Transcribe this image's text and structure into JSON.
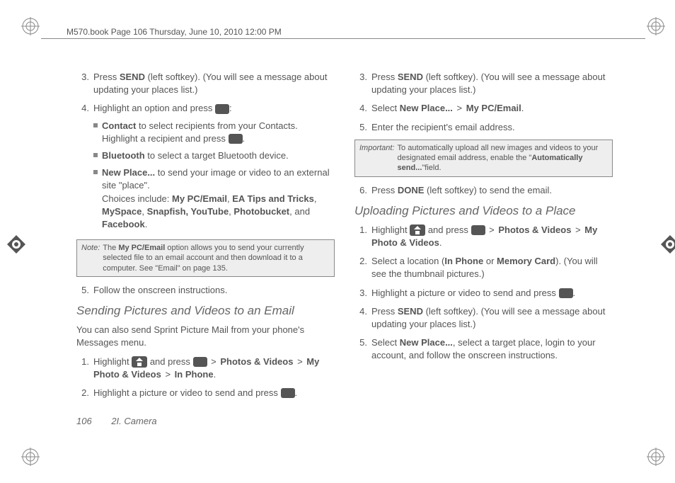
{
  "header": "M570.book  Page 106  Thursday, June 10, 2010  12:00 PM",
  "left": {
    "s3": {
      "n": "3.",
      "a": "Press ",
      "b": "SEND",
      "c": " (left softkey). (You will see a message about updating your places list.)"
    },
    "s4": {
      "n": "4.",
      "a": "Highlight an option and press ",
      "c": ":"
    },
    "s4a": {
      "b": "Contact",
      "t1": " to select recipients from your Contacts. Highlight a recipient and press ",
      "t2": "."
    },
    "s4b": {
      "b": "Bluetooth",
      "t": " to select a target Bluetooth device."
    },
    "s4c": {
      "b": "New Place...",
      "t1": " to send your image or video to an external site \"place\".",
      "t2": "Choices include: ",
      "l1": "My PC/Email",
      "l2": "EA Tips and Tricks",
      "l3": "MySpace",
      "l4": "Snapfish, YouTube",
      "l5": "Photobucket",
      "and": ", and ",
      "l6": "Facebook",
      "dot": "."
    },
    "note": {
      "label": "Note:",
      "a": "The ",
      "b": "My PC/Email",
      "c": " option allows you to send your currently selected file to an email account and then download it to a computer. See \"Email\" on page 135."
    },
    "s5": {
      "n": "5.",
      "t": "Follow the onscreen instructions."
    },
    "h1": "Sending Pictures and Videos to an Email",
    "p1": "You can also send Sprint Picture Mail from your phone's Messages menu.",
    "e1": {
      "n": "1.",
      "a": "Highlight ",
      "b": " and press ",
      "g": ">",
      "l1": "Photos & Videos",
      "l2": "My Photo & Videos",
      "l3": "In Phone",
      "dot": "."
    },
    "e2": {
      "n": "2.",
      "a": "Highlight a picture or video to send and press ",
      "dot": "."
    }
  },
  "right": {
    "s3": {
      "n": "3.",
      "a": "Press ",
      "b": "SEND",
      "c": " (left softkey). (You will see a message about updating your places list.)"
    },
    "s4": {
      "n": "4.",
      "a": "Select ",
      "b": "New Place...",
      "g": ">",
      "c": "My PC/Email",
      "dot": "."
    },
    "s5": {
      "n": "5.",
      "t": "Enter the recipient's email address."
    },
    "imp": {
      "label": "Important:",
      "a": "To automatically upload all new images and videos to your designated email address, enable the \"",
      "b": "Automatically send...",
      "c": "\"field."
    },
    "s6": {
      "n": "6.",
      "a": "Press ",
      "b": "DONE",
      "c": " (left softkey) to send the email."
    },
    "h1": "Uploading Pictures and Videos to a Place",
    "u1": {
      "n": "1.",
      "a": "Highlight ",
      "b": " and press ",
      "g": ">",
      "l1": "Photos & Videos",
      "l2": "My Photo & Videos",
      "dot": "."
    },
    "u2": {
      "n": "2.",
      "a": "Select a location (",
      "b": "In Phone",
      "c": " or ",
      "d": "Memory Card",
      "e": "). (You will see the thumbnail pictures.)"
    },
    "u3": {
      "n": "3.",
      "a": "Highlight a picture or video to send and press ",
      "dot": "."
    },
    "u4": {
      "n": "4.",
      "a": "Press ",
      "b": "SEND",
      "c": " (left softkey). (You will see a message about updating your places list.)"
    },
    "u5": {
      "n": "5.",
      "a": "Select ",
      "b": "New Place...",
      "c": ", select a target place, login to your account, and follow the onscreen instructions."
    }
  },
  "footer": {
    "page": "106",
    "section": "2I. Camera"
  }
}
